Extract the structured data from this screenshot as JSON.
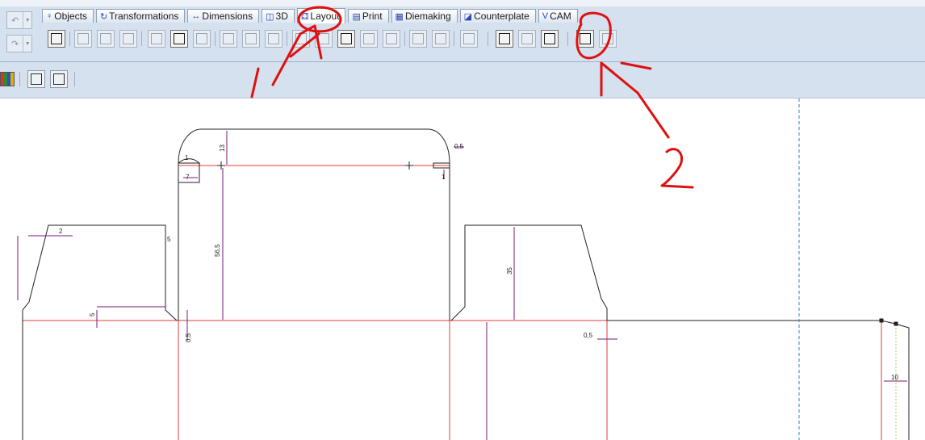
{
  "tabs": [
    {
      "label": "Objects",
      "icon": "objects-icon"
    },
    {
      "label": "Transformations",
      "icon": "transformations-icon"
    },
    {
      "label": "Dimensions",
      "icon": "dimensions-icon"
    },
    {
      "label": "3D",
      "icon": "cube-icon"
    },
    {
      "label": "Layout",
      "icon": "layout-icon",
      "active": true
    },
    {
      "label": "Print",
      "icon": "print-icon"
    },
    {
      "label": "Diemaking",
      "icon": "diemaking-icon"
    },
    {
      "label": "Counterplate",
      "icon": "counterplate-icon"
    },
    {
      "label": "CAM",
      "icon": "cam-icon"
    }
  ],
  "dimensions": {
    "d13": "13",
    "d05_top": "0,5",
    "d1_a": "1",
    "d7": "7",
    "d1_b": "1",
    "d2": "2",
    "d5_a": "5",
    "d56_5": "56,5",
    "d5_b": "5",
    "d05_mid": "0,5",
    "d35": "35",
    "d05_right": "0,5",
    "d10": "10"
  },
  "annotations": {
    "mark1": "1",
    "mark2": "2"
  },
  "colors": {
    "ribbon_bg": "#d5e1ef",
    "cut_line": "#222222",
    "crease_line": "#e23b3b",
    "dimension_line": "#7a1a7a",
    "guide_line": "#2a8aa6",
    "annotation": "#e01010"
  }
}
